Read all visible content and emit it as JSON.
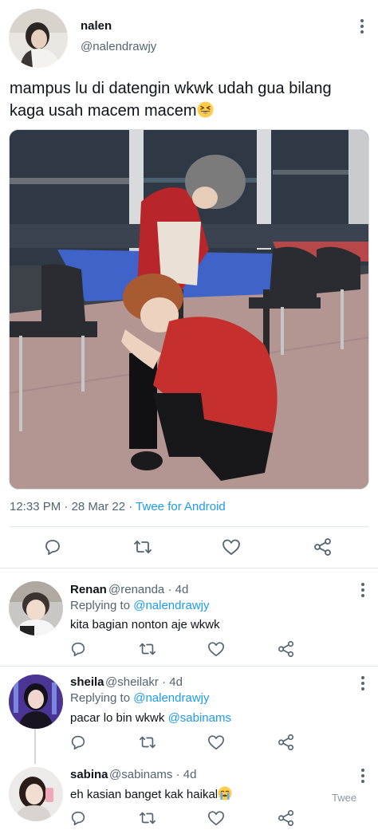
{
  "tweet": {
    "author_name": "nalen",
    "author_handle": "@nalendrawjy",
    "text": "mampus lu di datengin wkwk udah gua bilang kaga usah macem macem",
    "emoji": "grinning-squinting-face",
    "time": "12:33 PM",
    "separator": " · ",
    "date": "28 Mar 22",
    "source": "Twee for Android"
  },
  "replies": [
    {
      "name": "Renan",
      "handle": "@renanda",
      "age": "4d",
      "replying_label": "Replying to ",
      "replying_to": "@nalendrawjy",
      "text": "kita bagian nonton aje wkwk"
    },
    {
      "name": "sheila",
      "handle": "@sheilakr",
      "age": "4d",
      "replying_label": "Replying to ",
      "replying_to": "@nalendrawjy",
      "text": "pacar lo bin wkwk ",
      "mention": "@sabinams"
    },
    {
      "name": "sabina",
      "handle": "@sabinams",
      "age": "4d",
      "text": "eh kasian banget kak haikal",
      "emoji": "loudly-crying-face",
      "translate_label": "Twee"
    }
  ],
  "colors": {
    "text_primary": "#0f1419",
    "text_secondary": "#536471",
    "link": "#1d9bf0",
    "divider": "#e1e6ea"
  },
  "icons": [
    "more-icon",
    "reply-icon",
    "retweet-icon",
    "like-icon",
    "share-icon"
  ]
}
